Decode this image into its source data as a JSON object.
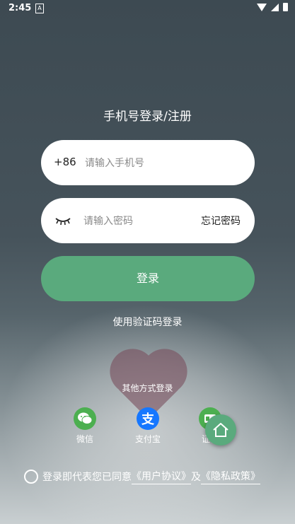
{
  "status_bar": {
    "time": "2:45",
    "notification_icon": "A"
  },
  "header": {
    "title": "手机号登录/注册"
  },
  "phone_field": {
    "prefix": "+86",
    "placeholder": "请输入手机号",
    "value": ""
  },
  "password_field": {
    "placeholder": "请输入密码",
    "value": "",
    "forgot_label": "忘记密码"
  },
  "login_button": {
    "label": "登录"
  },
  "sms_login": {
    "label": "使用验证码登录"
  },
  "other_methods": {
    "title": "其他方式登录",
    "items": [
      {
        "label": "微信",
        "icon": "wechat-icon",
        "color": "#4caf50"
      },
      {
        "label": "支付宝",
        "icon": "alipay-icon",
        "color": "#1677ff"
      },
      {
        "label": "证件",
        "icon": "id-card-icon",
        "color": "#4caf50"
      }
    ]
  },
  "agreement": {
    "prefix": "登录即代表您已同意",
    "user_agreement": "《用户协议》",
    "conjunction": "及",
    "privacy_policy": "《隐私政策》"
  },
  "colors": {
    "accent": "#5aaa7d"
  }
}
